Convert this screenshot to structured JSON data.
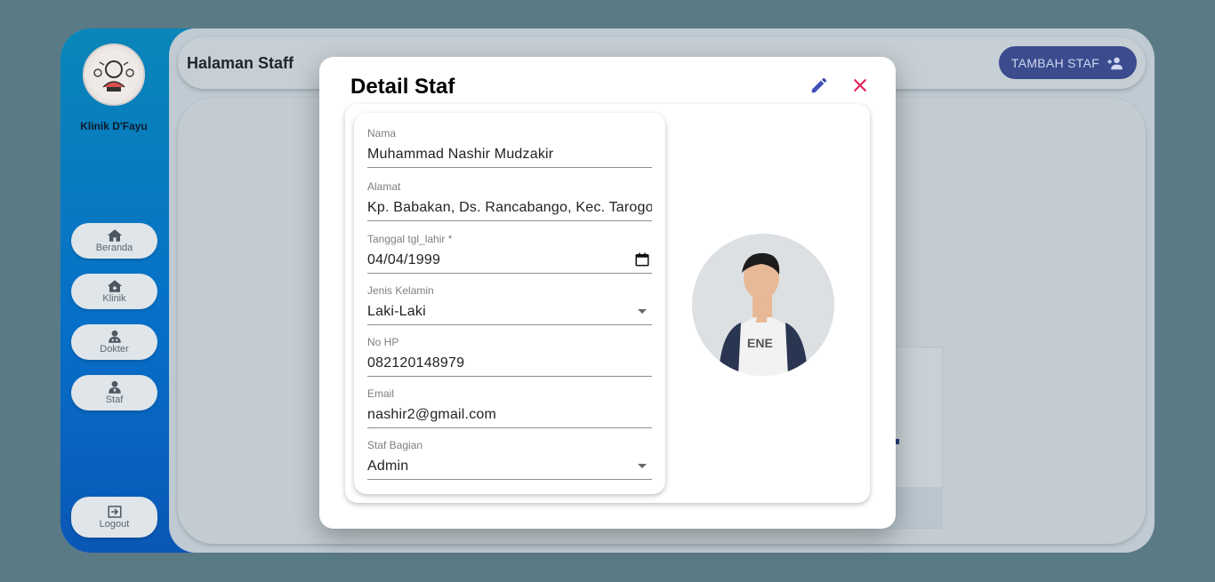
{
  "sidebar": {
    "clinic_name": "Klinik D'Fayu",
    "nav": [
      {
        "label": "Beranda"
      },
      {
        "label": "Klinik"
      },
      {
        "label": "Dokter"
      },
      {
        "label": "Staf"
      }
    ],
    "logout_label": "Logout"
  },
  "header": {
    "title": "Halaman Staff",
    "add_button_label": "TAMBAH STAF"
  },
  "modal": {
    "title": "Detail Staf",
    "fields": {
      "nama": {
        "label": "Nama",
        "value": "Muhammad Nashir Mudzakir"
      },
      "alamat": {
        "label": "Alamat",
        "value": "Kp. Babakan, Ds. Rancabango, Kec. Tarogong"
      },
      "tanggal_lahir": {
        "label": "Tanggal tgl_lahir *",
        "value": "04/04/1999"
      },
      "jenis_kelamin": {
        "label": "Jenis Kelamin",
        "value": "Laki-Laki"
      },
      "no_hp": {
        "label": "No HP",
        "value": "082120148979"
      },
      "email": {
        "label": "Email",
        "value": "nashir2@gmail.com"
      },
      "staf_bagian": {
        "label": "Staf Bagian",
        "value": "Admin"
      }
    }
  },
  "colors": {
    "accent": "#3f51b5",
    "close": "#e0245e",
    "sidebar_top": "#0a86b8",
    "sidebar_bottom": "#0a57b5"
  }
}
